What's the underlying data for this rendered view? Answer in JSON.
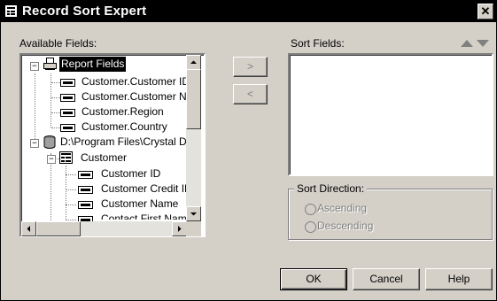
{
  "window": {
    "title": "Record Sort Expert",
    "close_glyph": "✕"
  },
  "available": {
    "label": "Available Fields:",
    "nodes": [
      {
        "text": "Report Fields",
        "selected": true
      },
      {
        "text": "Customer.Customer ID"
      },
      {
        "text": "Customer.Customer Nai"
      },
      {
        "text": "Customer.Region"
      },
      {
        "text": "Customer.Country"
      },
      {
        "text": "D:\\Program Files\\Crystal De"
      },
      {
        "text": "Customer"
      },
      {
        "text": "Customer ID"
      },
      {
        "text": "Customer Credit ID"
      },
      {
        "text": "Customer Name"
      },
      {
        "text": "Contact First Name"
      }
    ]
  },
  "move": {
    "add_label": ">",
    "remove_label": "<"
  },
  "sort": {
    "label": "Sort Fields:",
    "direction_label": "Sort Direction:",
    "ascending": "Ascending",
    "descending": "Descending"
  },
  "buttons": {
    "ok": "OK",
    "cancel": "Cancel",
    "help": "Help"
  },
  "icons": [
    "report-icon",
    "field-icon",
    "database-icon",
    "table-icon",
    "up-arrow-icon",
    "down-arrow-icon",
    "minus-icon"
  ]
}
